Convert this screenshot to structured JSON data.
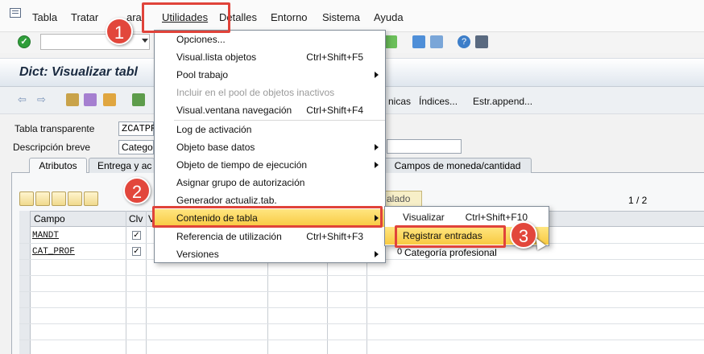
{
  "menubar": {
    "items": [
      "Tabla",
      "Tratar",
      "Pasar a",
      "Utilidades",
      "Detalles",
      "Entorno",
      "Sistema",
      "Ayuda"
    ],
    "tratar_partial": "ara"
  },
  "title": "Dict: Visualizar tabl",
  "app_toolbar": {
    "links": [
      "Índices...",
      "Estr.append..."
    ],
    "partial_link": "nicas"
  },
  "fields": {
    "table_type_label": "Tabla transparente",
    "table_name": "ZCATPR",
    "short_desc_label": "Descripción breve",
    "short_desc_value": "Catego"
  },
  "tabs": [
    "Atributos",
    "Entrega y ac",
    "Campos de moneda/cantidad"
  ],
  "grid": {
    "pager": "1 / 2",
    "headers": [
      "Campo",
      "Clv",
      "V"
    ],
    "rows": [
      {
        "field": "MANDT",
        "key": true,
        "key_mark": "✓",
        "desc": ""
      },
      {
        "field": "CAT_PROF",
        "key": true,
        "key_mark": "✓",
        "desc": "Categoría profesional",
        "len": "0"
      }
    ],
    "hidden_button": "alado"
  },
  "menu": {
    "items": [
      {
        "label": "Opciones...",
        "shortcut": "",
        "sub": false,
        "disabled": false
      },
      {
        "label": "Visual.lista objetos",
        "shortcut": "Ctrl+Shift+F5",
        "sub": false,
        "disabled": false
      },
      {
        "label": "Pool trabajo",
        "shortcut": "",
        "sub": true,
        "disabled": false
      },
      {
        "label": "Incluir en el pool de objetos inactivos",
        "shortcut": "",
        "sub": false,
        "disabled": true
      },
      {
        "label": "Visual.ventana navegación",
        "shortcut": "Ctrl+Shift+F4",
        "sub": false,
        "disabled": false
      },
      {
        "label": "Log de activación",
        "shortcut": "",
        "sub": false,
        "disabled": false
      },
      {
        "label": "Objeto base datos",
        "shortcut": "",
        "sub": true,
        "disabled": false
      },
      {
        "label": "Objeto de tiempo de ejecución",
        "shortcut": "",
        "sub": true,
        "disabled": false
      },
      {
        "label": "Asignar grupo de autorización",
        "shortcut": "",
        "sub": false,
        "disabled": false
      },
      {
        "label": "Generador actualiz.tab.",
        "shortcut": "",
        "sub": false,
        "disabled": false
      },
      {
        "label": "Contenido de tabla",
        "shortcut": "",
        "sub": true,
        "disabled": false
      },
      {
        "label": "Referencia de utilización",
        "shortcut": "Ctrl+Shift+F3",
        "sub": false,
        "disabled": false
      },
      {
        "label": "Versiones",
        "shortcut": "",
        "sub": true,
        "disabled": false
      }
    ]
  },
  "submenu": {
    "items": [
      {
        "label": "Visualizar",
        "shortcut": "Ctrl+Shift+F10"
      },
      {
        "label": "Registrar entradas",
        "shortcut": ""
      }
    ]
  },
  "annotations": {
    "badge1": "1",
    "badge2": "2",
    "badge3": "3"
  },
  "colors": {
    "annotation": "#e0433a",
    "highlight": "#f8c941",
    "title": "#1a2a40"
  }
}
